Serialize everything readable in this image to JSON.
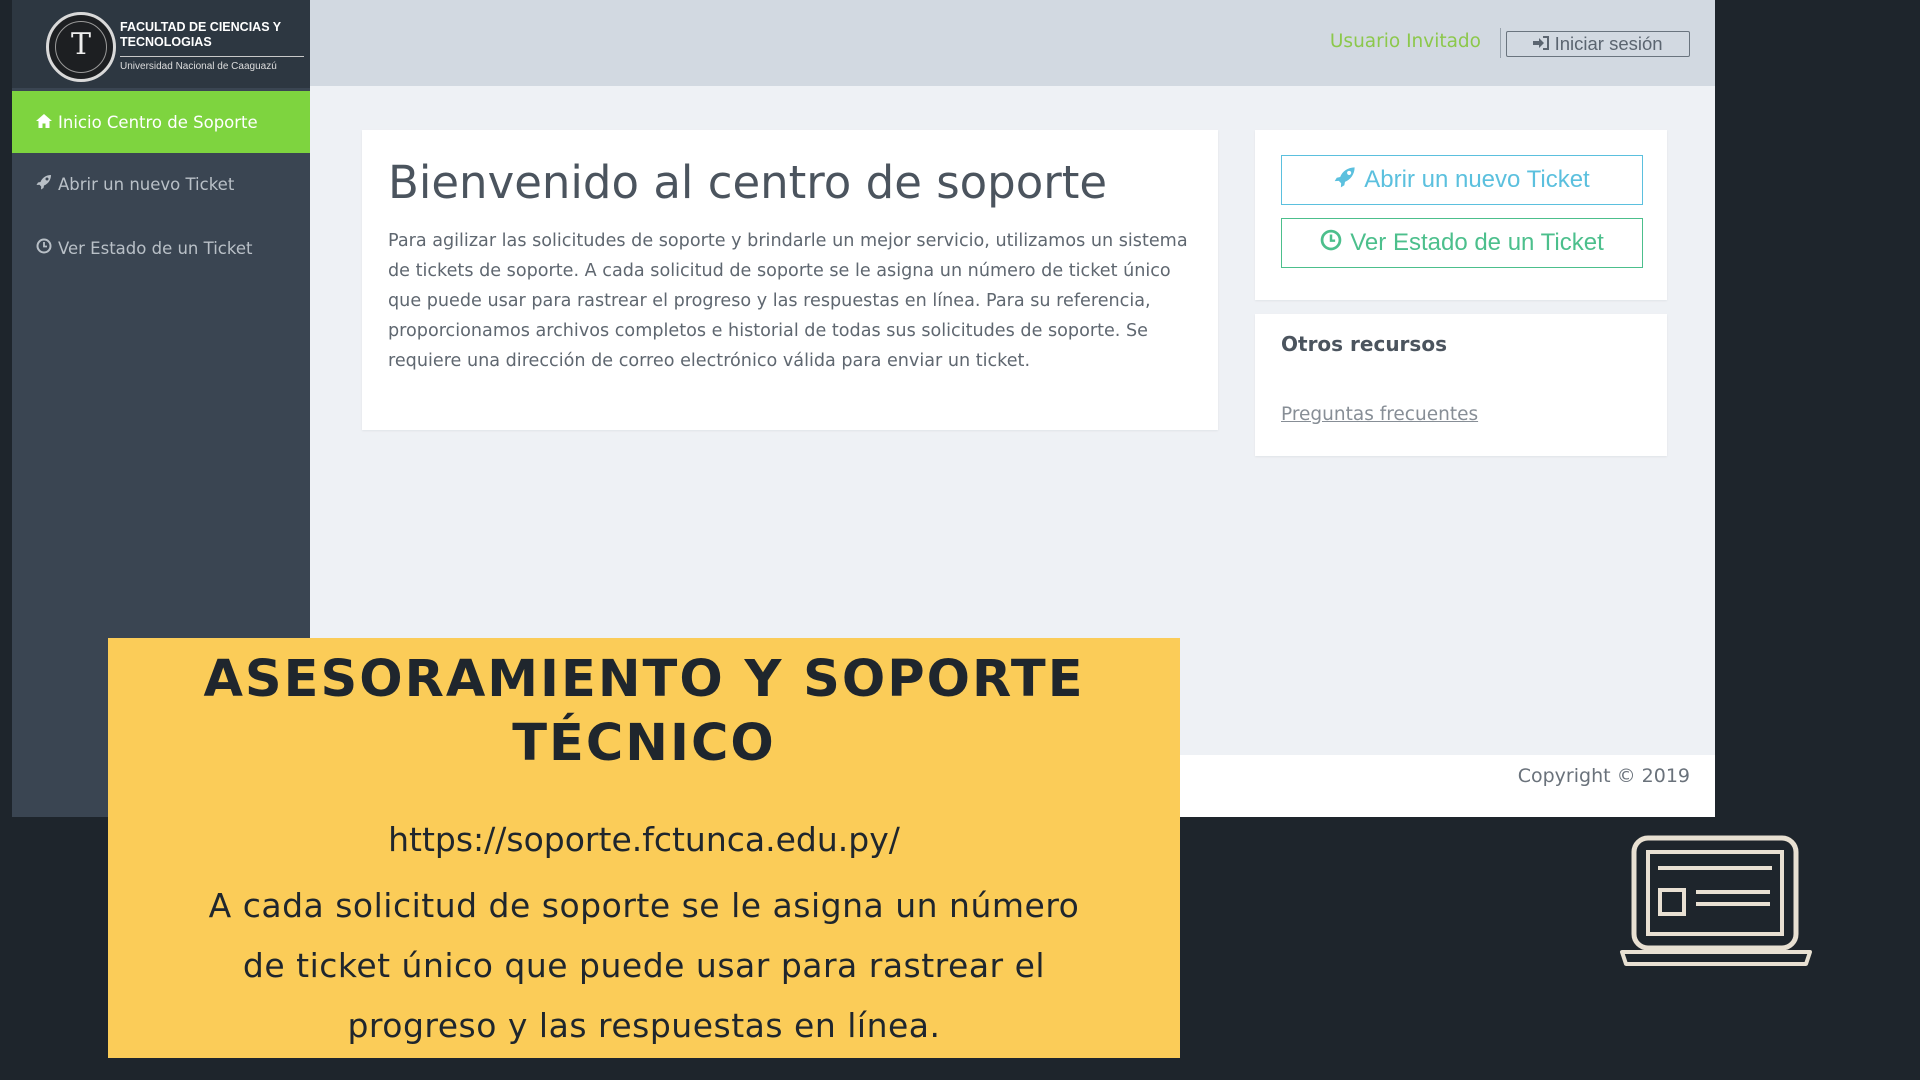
{
  "sidebar": {
    "logo": {
      "title": "Facultad de Ciencias y Tecnologias",
      "subtitle": "Universidad Nacional de Caaguazú",
      "seal_letter": "T"
    },
    "items": [
      {
        "label": "Inicio Centro de Soporte",
        "icon": "home-icon",
        "active": true
      },
      {
        "label": "Abrir un nuevo Ticket",
        "icon": "rocket-icon",
        "active": false
      },
      {
        "label": "Ver Estado de un Ticket",
        "icon": "clock-icon",
        "active": false
      }
    ]
  },
  "header": {
    "guest_label": "Usuario Invitado",
    "login_label": "Iniciar sesión"
  },
  "main": {
    "title": "Bienvenido al centro de soporte",
    "body": "Para agilizar las solicitudes de soporte y brindarle un mejor servicio, utilizamos un sistema de tickets de soporte. A cada solicitud de soporte se le asigna un número de ticket único que puede usar para rastrear el progreso y las respuestas en línea. Para su referencia, proporcionamos archivos completos e historial de todas sus solicitudes de soporte. Se requiere una dirección de correo electrónico válida para enviar un ticket."
  },
  "actions": {
    "open_ticket": "Abrir un nuevo Ticket",
    "ticket_status": "Ver Estado de un Ticket"
  },
  "resources": {
    "title": "Otros recursos",
    "faq_link": "Preguntas frecuentes"
  },
  "footer": {
    "copyright": "Copyright © 2019"
  },
  "banner": {
    "title": "ASESORAMIENTO Y SOPORTE TÉCNICO",
    "url": "https://soporte.fctunca.edu.py/",
    "text": "A cada solicitud de soporte se le asigna un número de ticket único que puede usar para rastrear el progreso y las respuestas en línea."
  },
  "colors": {
    "accent_green": "#7ed43f",
    "sidebar": "#3a4552",
    "banner_yellow": "#fbcc58",
    "background": "#1e252c",
    "info_blue": "#5bc0de",
    "success_green": "#4cbf8c"
  }
}
